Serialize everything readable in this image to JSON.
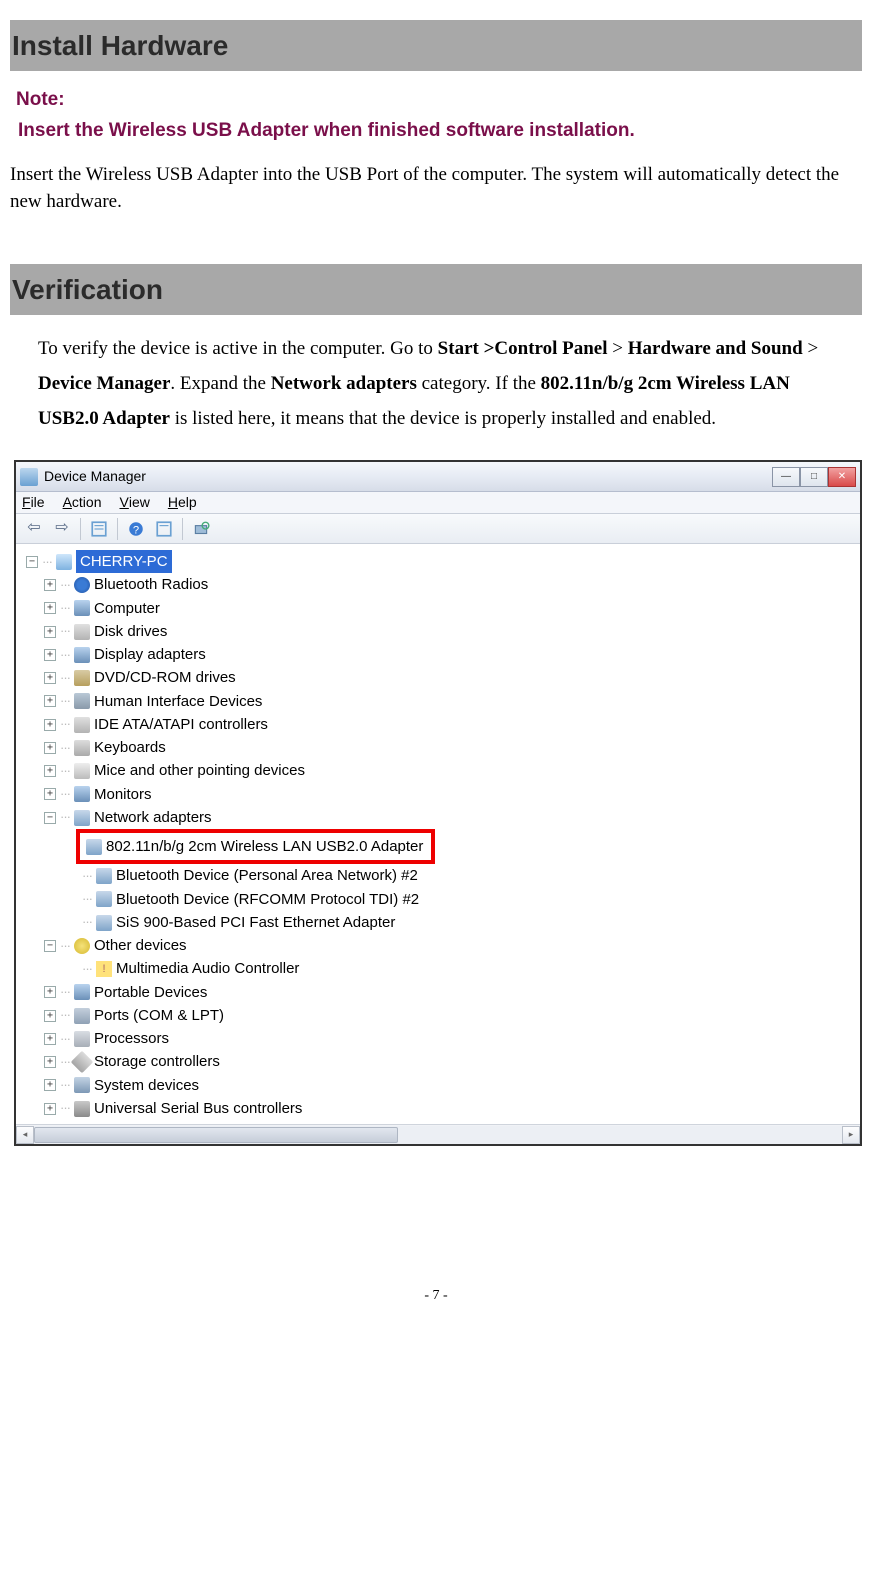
{
  "heading1": "Install Hardware",
  "note_label": "Note:",
  "note_text": "Insert the Wireless USB Adapter when finished software installation.",
  "para1": "Insert the Wireless USB Adapter into the USB Port of the computer. The system will automatically detect the new hardware.",
  "heading2": "Verification",
  "para2_a": "To verify the device is active in the computer. Go to ",
  "para2_b": "Start >Control Panel",
  "para2_c": " > ",
  "para2_d": "Hardware and Sound",
  "para2_e": " > ",
  "para2_f": "Device Manager",
  "para2_g": ". Expand the ",
  "para2_h": "Network adapters",
  "para2_i": " category. If the ",
  "para2_j": "802.11n/b/g 2cm Wireless LAN USB2.0 Adapter",
  "para2_k": " is listed here, it means that the device is properly installed and enabled.",
  "dm": {
    "title": "Device Manager",
    "menu": {
      "file": "File",
      "action": "Action",
      "view": "View",
      "help": "Help"
    },
    "root": "CHERRY-PC",
    "nodes": [
      "Bluetooth Radios",
      "Computer",
      "Disk drives",
      "Display adapters",
      "DVD/CD-ROM drives",
      "Human Interface Devices",
      "IDE ATA/ATAPI controllers",
      "Keyboards",
      "Mice and other pointing devices",
      "Monitors",
      "Network adapters"
    ],
    "net_children": [
      "802.11n/b/g 2cm Wireless LAN USB2.0 Adapter",
      "Bluetooth Device (Personal Area Network) #2",
      "Bluetooth Device (RFCOMM Protocol TDI) #2",
      "SiS 900-Based PCI Fast Ethernet Adapter"
    ],
    "other_devices": "Other devices",
    "other_child": "Multimedia Audio Controller",
    "nodes2": [
      "Portable Devices",
      "Ports (COM & LPT)",
      "Processors",
      "Storage controllers",
      "System devices",
      "Universal Serial Bus controllers"
    ]
  },
  "page_number": "- 7 -"
}
